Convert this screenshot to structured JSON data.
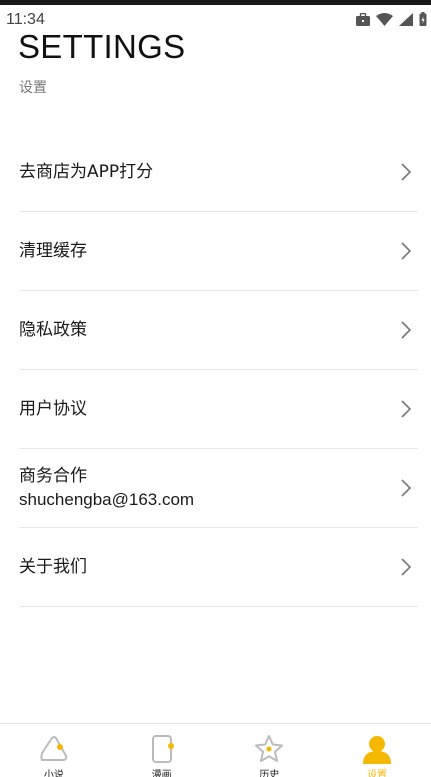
{
  "status": {
    "time": "11:34"
  },
  "header": {
    "title": "SETTINGS",
    "subtitle": "设置"
  },
  "menu": {
    "items": [
      {
        "label": "去商店为APP打分"
      },
      {
        "label": "清理缓存"
      },
      {
        "label": "隐私政策"
      },
      {
        "label": "用户协议"
      },
      {
        "label": "商务合作",
        "email": "shuchengba@163.com"
      },
      {
        "label": "关于我们"
      }
    ]
  },
  "tabs": [
    {
      "label": "小说",
      "icon": "novel-icon"
    },
    {
      "label": "漫画",
      "icon": "comic-icon"
    },
    {
      "label": "历史",
      "icon": "history-star-icon"
    },
    {
      "label": "设置",
      "icon": "settings-person-icon",
      "active": true
    }
  ],
  "colors": {
    "accent": "#f5b800",
    "text": "#111111",
    "divider": "#e6e6e6"
  }
}
